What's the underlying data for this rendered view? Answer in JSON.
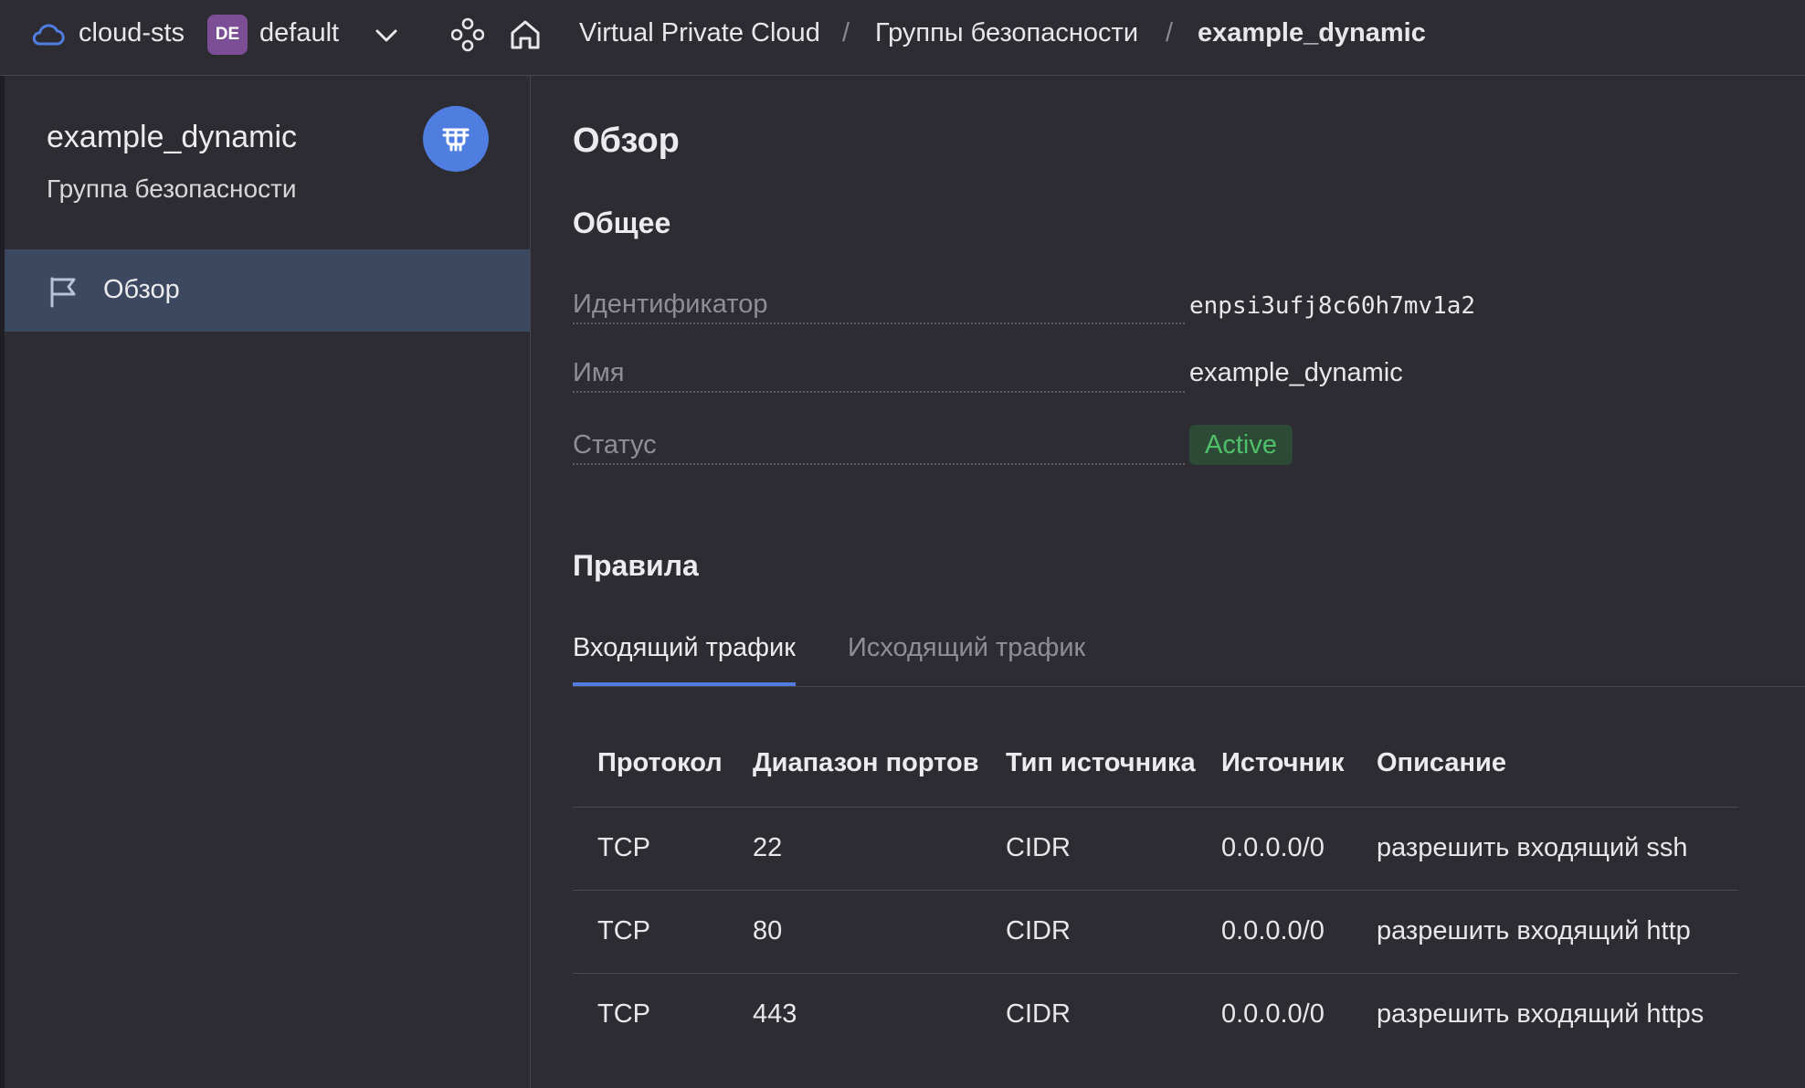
{
  "topbar": {
    "cloud_name": "cloud-sts",
    "folder_avatar": "DE",
    "folder_name": "default",
    "breadcrumbs": [
      {
        "label": "Virtual Private Cloud"
      },
      {
        "label": "Группы безопасности"
      },
      {
        "label": "example_dynamic"
      }
    ],
    "separator": "/",
    "icons": [
      "cloud-icon",
      "chevron-down-icon",
      "nodes-icon",
      "home-icon"
    ]
  },
  "sidebar": {
    "title": "example_dynamic",
    "subtitle": "Группа безопасности",
    "badge_icon": "security-group-icon",
    "items": [
      {
        "label": "Обзор",
        "icon": "flag-icon",
        "active": true
      }
    ]
  },
  "main": {
    "page_title": "Обзор",
    "general": {
      "title": "Общее",
      "props": [
        {
          "label": "Идентификатор",
          "value": "enpsi3ufj8c60h7mv1a2"
        },
        {
          "label": "Имя",
          "value": "example_dynamic"
        },
        {
          "label": "Статус",
          "value": "Active"
        }
      ]
    },
    "rules": {
      "title": "Правила",
      "tabs": [
        {
          "label": "Входящий трафик",
          "active": true
        },
        {
          "label": "Исходящий трафик",
          "active": false
        }
      ],
      "columns": [
        "Протокол",
        "Диапазон портов",
        "Тип источника",
        "Источник",
        "Описание"
      ],
      "rows": [
        [
          "TCP",
          "22",
          "CIDR",
          "0.0.0.0/0",
          "разрешить входящий ssh"
        ],
        [
          "TCP",
          "80",
          "CIDR",
          "0.0.0.0/0",
          "разрешить входящий http"
        ],
        [
          "TCP",
          "443",
          "CIDR",
          "0.0.0.0/0",
          "разрешить входящий https"
        ]
      ]
    }
  },
  "colors": {
    "background": "#2d2c33",
    "accent": "#4f7ee0",
    "sidebar_active": "#3c4760",
    "status_active_text": "#4fbf6a",
    "status_active_bg": "#2c4a35",
    "avatar": "#7b4e96"
  }
}
